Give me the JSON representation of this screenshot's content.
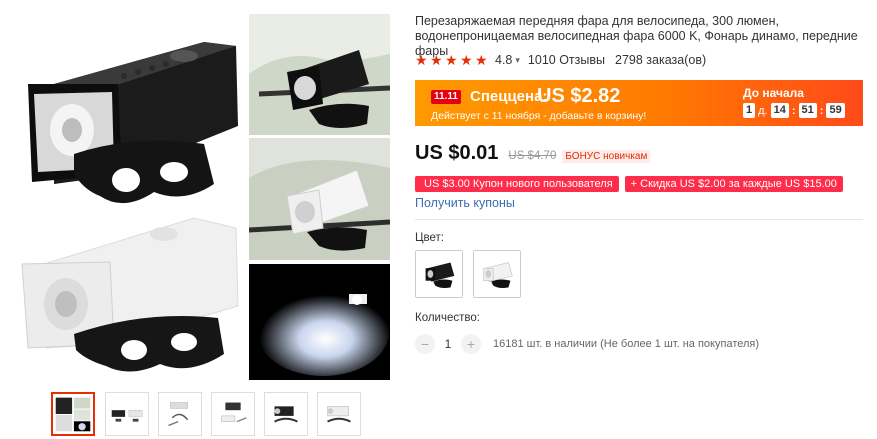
{
  "product": {
    "title": "Перезаряжаемая передняя фара для велосипеда, 300 люмен, водонепроницаемая велосипедная фара 6000 K, Фонарь динамо, передние фары",
    "rating": "4.8",
    "reviews": "1010 Отзывы",
    "orders": "2798 заказа(ов)",
    "stars": [
      "★",
      "★",
      "★",
      "★",
      "★"
    ]
  },
  "promo": {
    "badge": "11.11",
    "label": "Спеццена:",
    "price": "US $2.82",
    "subtitle": "Действует с 11 ноября - добавьте в корзину!",
    "countdown_label": "До начала",
    "days": "1",
    "days_unit": "д.",
    "hours": "14",
    "minutes": "51",
    "seconds": "59",
    "sep": ":"
  },
  "pricing": {
    "price": "US $0.01",
    "old_price": "US $4.70",
    "bonus": "БОНУС новичкам"
  },
  "coupons": {
    "c1": "US $3.00 Купон нового пользователя",
    "c2": "+ Скидка US $2.00 за каждые US $15.00",
    "get": "Получить купоны"
  },
  "options": {
    "color_label": "Цвет:",
    "swatches": [
      "black",
      "white"
    ]
  },
  "quantity": {
    "label": "Количество:",
    "minus": "−",
    "plus": "+",
    "value": "1",
    "stock": "16181 шт. в наличии (Не более 1 шт. на покупателя)"
  },
  "gallery": {
    "thumb_count": 6,
    "active_index": 0
  },
  "colors": {
    "accent": "#e62e04",
    "promo_start": "#ff9a00",
    "promo_end": "#ff4a1a",
    "link": "#3b6db4"
  }
}
